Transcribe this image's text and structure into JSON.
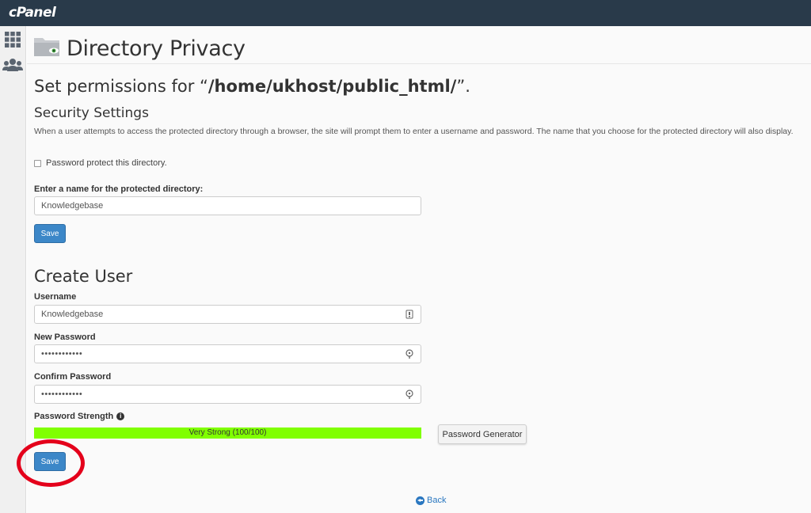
{
  "app": {
    "logo": "cPanel"
  },
  "sidebar": {
    "icons": [
      "grid-icon",
      "users-icon"
    ]
  },
  "header": {
    "title": "Directory Privacy",
    "icon": "folder-eye-icon"
  },
  "permissions": {
    "prefix": "Set permissions for “",
    "path": "/home/ukhost/public_html/",
    "suffix": "”."
  },
  "security": {
    "title": "Security Settings",
    "description": "When a user attempts to access the protected directory through a browser, the site will prompt them to enter a username and password. The name that you choose for the protected directory will also display.",
    "checkbox_label": "Password protect this directory.",
    "checkbox_checked": false,
    "name_label": "Enter a name for the protected directory:",
    "name_value": "Knowledgebase",
    "save_label": "Save"
  },
  "create_user": {
    "title": "Create User",
    "username_label": "Username",
    "username_value": "Knowledgebase",
    "new_password_label": "New Password",
    "new_password_value": "••••••••••••",
    "confirm_password_label": "Confirm Password",
    "confirm_password_value": "••••••••••••",
    "strength_label": "Password Strength",
    "strength_text": "Very Strong (100/100)",
    "strength_percent": 100,
    "strength_color": "#80ff00",
    "generator_label": "Password Generator",
    "save_label": "Save"
  },
  "back_label": "Back",
  "colors": {
    "topbar": "#293a4a",
    "primary": "#3c87c8",
    "annotation": "#e4001b",
    "link": "#2a77c0"
  }
}
